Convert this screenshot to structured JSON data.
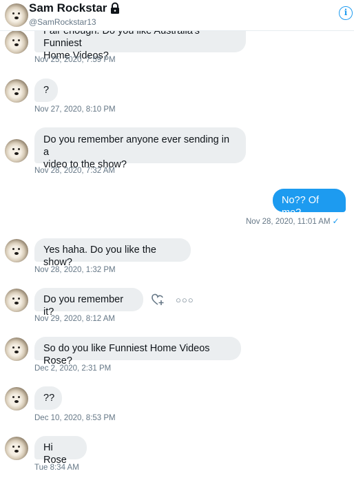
{
  "header": {
    "name": "Sam Rockstar",
    "handle": "@SamRockstar13",
    "lock_icon": "lock-icon",
    "info_icon": "info-icon",
    "info_glyph": "i"
  },
  "colors": {
    "accent": "#1d9bf0",
    "bubble_in": "#ebeef0",
    "meta_text": "#657786"
  },
  "messages": [
    {
      "text_line1": "Fair enough. Do you like Australia's Funniest",
      "text_line2": "Home Videos?",
      "time": "Nov 25, 2020, 7:59 PM"
    },
    {
      "text": "?",
      "time": "Nov 27, 2020, 8:10 PM"
    },
    {
      "text_line1": "Do you remember anyone ever sending in a",
      "text_line2": "video to the show?",
      "time": "Nov 28, 2020, 7:32 AM"
    },
    {
      "text": "No?? Of me?",
      "time": "Nov 28, 2020, 11:01 AM",
      "check": "✓"
    },
    {
      "text": "Yes haha. Do you like the show?",
      "time": "Nov 28, 2020, 1:32 PM"
    },
    {
      "text": "Do you remember it?",
      "time": "Nov 29, 2020, 8:12 AM",
      "more": "○○○"
    },
    {
      "text": "So do you like Funniest Home Videos Rose?",
      "time": "Dec 2, 2020, 2:31 PM"
    },
    {
      "text": "??",
      "time": "Dec 10, 2020, 8:53 PM"
    },
    {
      "text": "Hi Rose",
      "time": "Tue 8:34 AM"
    }
  ]
}
